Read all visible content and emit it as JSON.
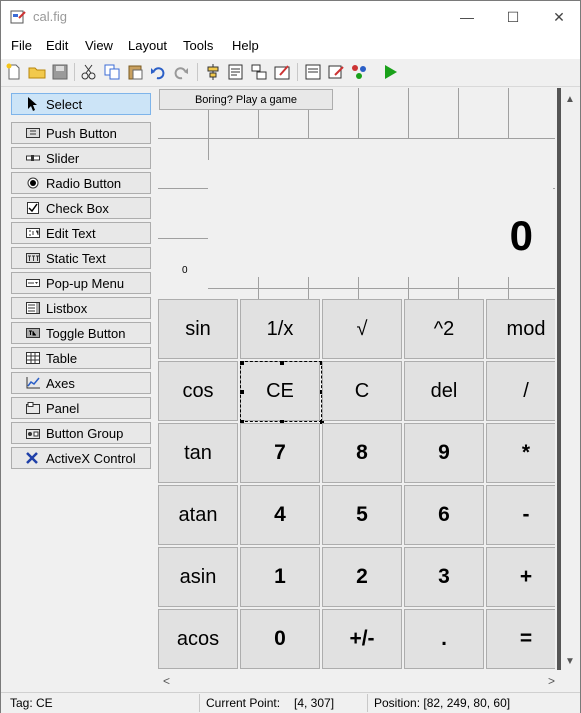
{
  "window": {
    "title": "cal.fig",
    "minimize_glyph": "—",
    "maximize_glyph": "☐",
    "close_glyph": "✕"
  },
  "menu": [
    "File",
    "Edit",
    "View",
    "Layout",
    "Tools",
    "Help"
  ],
  "palette": [
    {
      "label": "Select",
      "icon": "select-arrow-icon",
      "selected": true
    },
    {
      "label": "Push Button",
      "icon": "push-button-icon"
    },
    {
      "label": "Slider",
      "icon": "slider-icon"
    },
    {
      "label": "Radio Button",
      "icon": "radio-button-icon"
    },
    {
      "label": "Check Box",
      "icon": "check-box-icon"
    },
    {
      "label": "Edit Text",
      "icon": "edit-text-icon"
    },
    {
      "label": "Static Text",
      "icon": "static-text-icon"
    },
    {
      "label": "Pop-up Menu",
      "icon": "popup-menu-icon"
    },
    {
      "label": "Listbox",
      "icon": "listbox-icon"
    },
    {
      "label": "Toggle Button",
      "icon": "toggle-button-icon"
    },
    {
      "label": "Table",
      "icon": "table-icon"
    },
    {
      "label": "Axes",
      "icon": "axes-icon"
    },
    {
      "label": "Panel",
      "icon": "panel-icon"
    },
    {
      "label": "Button Group",
      "icon": "button-group-icon"
    },
    {
      "label": "ActiveX Control",
      "icon": "activex-icon"
    }
  ],
  "canvas": {
    "game_button": "Boring? Play a game",
    "display_value": "0",
    "small_label": "0",
    "keys": [
      [
        "sin",
        "1/x",
        "√",
        "^2",
        "mod"
      ],
      [
        "cos",
        "CE",
        "C",
        "del",
        "/"
      ],
      [
        "tan",
        "7",
        "8",
        "9",
        "*"
      ],
      [
        "atan",
        "4",
        "5",
        "6",
        "-"
      ],
      [
        "asin",
        "1",
        "2",
        "3",
        "+"
      ],
      [
        "acos",
        "0",
        "+/-",
        ".",
        "="
      ]
    ],
    "selected_key": "CE"
  },
  "scroll": {
    "up": "▲",
    "down": "▼",
    "left": "<",
    "right": ">"
  },
  "status": {
    "tag": "Tag: CE",
    "current_point_label": "Current Point:",
    "current_point_value": "[4, 307]",
    "position": "Position: [82, 249, 80, 60]"
  },
  "colors": {
    "selected_bg": "#cce4f7",
    "run_green": "#1aa11a"
  }
}
